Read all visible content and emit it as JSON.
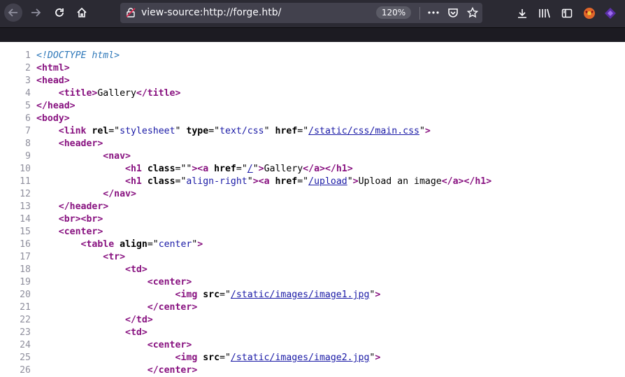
{
  "browser": {
    "url": "view-source:http://forge.htb/",
    "zoom": "120%"
  },
  "icons": {
    "back": "back-arrow-icon",
    "forward": "forward-arrow-icon",
    "reload": "reload-icon",
    "home": "home-icon",
    "insecure": "insecure-lock-icon",
    "more": "page-actions-icon",
    "pocket": "pocket-icon",
    "bookmark": "bookmark-star-icon",
    "downloads": "downloads-icon",
    "library": "library-icon",
    "sidebar": "sidebar-icon",
    "ext1": "extension-icon",
    "ext2": "extension-icon"
  },
  "colors": {
    "toolbar": "#2b2a33",
    "tag": "#881280",
    "value": "#1a1aa6",
    "doctype": "#2e78b9",
    "line_number": "#8f8f9d"
  },
  "source_lines": [
    {
      "n": "1",
      "parts": [
        {
          "t": "doctype",
          "s": "<!DOCTYPE html>"
        }
      ]
    },
    {
      "n": "2",
      "parts": [
        {
          "t": "tag",
          "s": "<html>"
        }
      ]
    },
    {
      "n": "3",
      "parts": [
        {
          "t": "tag",
          "s": "<head>"
        }
      ]
    },
    {
      "n": "4",
      "parts": [
        {
          "t": "txt",
          "s": "    "
        },
        {
          "t": "tag",
          "s": "<title>"
        },
        {
          "t": "txt",
          "s": "Gallery"
        },
        {
          "t": "tag",
          "s": "</title>"
        }
      ]
    },
    {
      "n": "5",
      "parts": [
        {
          "t": "tag",
          "s": "</head>"
        }
      ]
    },
    {
      "n": "6",
      "parts": [
        {
          "t": "tag",
          "s": "<body>"
        }
      ]
    },
    {
      "n": "7",
      "parts": [
        {
          "t": "txt",
          "s": "    "
        },
        {
          "t": "tag",
          "s": "<link "
        },
        {
          "t": "attr",
          "s": "rel"
        },
        {
          "t": "txt",
          "s": "=\""
        },
        {
          "t": "val",
          "s": "stylesheet"
        },
        {
          "t": "txt",
          "s": "\" "
        },
        {
          "t": "attr",
          "s": "type"
        },
        {
          "t": "txt",
          "s": "=\""
        },
        {
          "t": "val",
          "s": "text/css"
        },
        {
          "t": "txt",
          "s": "\" "
        },
        {
          "t": "attr",
          "s": "href"
        },
        {
          "t": "txt",
          "s": "=\""
        },
        {
          "t": "link",
          "s": "/static/css/main.css"
        },
        {
          "t": "txt",
          "s": "\""
        },
        {
          "t": "tag",
          "s": ">"
        }
      ]
    },
    {
      "n": "8",
      "parts": [
        {
          "t": "txt",
          "s": "    "
        },
        {
          "t": "tag",
          "s": "<header>"
        }
      ]
    },
    {
      "n": "9",
      "parts": [
        {
          "t": "txt",
          "s": "            "
        },
        {
          "t": "tag",
          "s": "<nav>"
        }
      ]
    },
    {
      "n": "10",
      "parts": [
        {
          "t": "txt",
          "s": "                "
        },
        {
          "t": "tag",
          "s": "<h1 "
        },
        {
          "t": "attr",
          "s": "class"
        },
        {
          "t": "txt",
          "s": "=\"\""
        },
        {
          "t": "tag",
          "s": "><a "
        },
        {
          "t": "attr",
          "s": "href"
        },
        {
          "t": "txt",
          "s": "=\""
        },
        {
          "t": "link",
          "s": "/"
        },
        {
          "t": "txt",
          "s": "\""
        },
        {
          "t": "tag",
          "s": ">"
        },
        {
          "t": "txt",
          "s": "Gallery"
        },
        {
          "t": "tag",
          "s": "</a></h1>"
        }
      ]
    },
    {
      "n": "11",
      "parts": [
        {
          "t": "txt",
          "s": "                "
        },
        {
          "t": "tag",
          "s": "<h1 "
        },
        {
          "t": "attr",
          "s": "class"
        },
        {
          "t": "txt",
          "s": "=\""
        },
        {
          "t": "val",
          "s": "align-right"
        },
        {
          "t": "txt",
          "s": "\""
        },
        {
          "t": "tag",
          "s": "><a "
        },
        {
          "t": "attr",
          "s": "href"
        },
        {
          "t": "txt",
          "s": "=\""
        },
        {
          "t": "link",
          "s": "/upload"
        },
        {
          "t": "txt",
          "s": "\""
        },
        {
          "t": "tag",
          "s": ">"
        },
        {
          "t": "txt",
          "s": "Upload an image"
        },
        {
          "t": "tag",
          "s": "</a></h1>"
        }
      ]
    },
    {
      "n": "12",
      "parts": [
        {
          "t": "txt",
          "s": "            "
        },
        {
          "t": "tag",
          "s": "</nav>"
        }
      ]
    },
    {
      "n": "13",
      "parts": [
        {
          "t": "txt",
          "s": "    "
        },
        {
          "t": "tag",
          "s": "</header>"
        }
      ]
    },
    {
      "n": "14",
      "parts": [
        {
          "t": "txt",
          "s": "    "
        },
        {
          "t": "tag",
          "s": "<br><br>"
        }
      ]
    },
    {
      "n": "15",
      "parts": [
        {
          "t": "txt",
          "s": "    "
        },
        {
          "t": "tag",
          "s": "<center>"
        }
      ]
    },
    {
      "n": "16",
      "parts": [
        {
          "t": "txt",
          "s": "        "
        },
        {
          "t": "tag",
          "s": "<table "
        },
        {
          "t": "attr",
          "s": "align"
        },
        {
          "t": "txt",
          "s": "=\""
        },
        {
          "t": "val",
          "s": "center"
        },
        {
          "t": "txt",
          "s": "\""
        },
        {
          "t": "tag",
          "s": ">"
        }
      ]
    },
    {
      "n": "17",
      "parts": [
        {
          "t": "txt",
          "s": "            "
        },
        {
          "t": "tag",
          "s": "<tr>"
        }
      ]
    },
    {
      "n": "18",
      "parts": [
        {
          "t": "txt",
          "s": "                "
        },
        {
          "t": "tag",
          "s": "<td>"
        }
      ]
    },
    {
      "n": "19",
      "parts": [
        {
          "t": "txt",
          "s": "                    "
        },
        {
          "t": "tag",
          "s": "<center>"
        }
      ]
    },
    {
      "n": "20",
      "parts": [
        {
          "t": "txt",
          "s": "                         "
        },
        {
          "t": "tag",
          "s": "<img "
        },
        {
          "t": "attr",
          "s": "src"
        },
        {
          "t": "txt",
          "s": "=\""
        },
        {
          "t": "link",
          "s": "/static/images/image1.jpg"
        },
        {
          "t": "txt",
          "s": "\""
        },
        {
          "t": "tag",
          "s": ">"
        }
      ]
    },
    {
      "n": "21",
      "parts": [
        {
          "t": "txt",
          "s": "                    "
        },
        {
          "t": "tag",
          "s": "</center>"
        }
      ]
    },
    {
      "n": "22",
      "parts": [
        {
          "t": "txt",
          "s": "                "
        },
        {
          "t": "tag",
          "s": "</td>"
        }
      ]
    },
    {
      "n": "23",
      "parts": [
        {
          "t": "txt",
          "s": "                "
        },
        {
          "t": "tag",
          "s": "<td>"
        }
      ]
    },
    {
      "n": "24",
      "parts": [
        {
          "t": "txt",
          "s": "                    "
        },
        {
          "t": "tag",
          "s": "<center>"
        }
      ]
    },
    {
      "n": "25",
      "parts": [
        {
          "t": "txt",
          "s": "                         "
        },
        {
          "t": "tag",
          "s": "<img "
        },
        {
          "t": "attr",
          "s": "src"
        },
        {
          "t": "txt",
          "s": "=\""
        },
        {
          "t": "link",
          "s": "/static/images/image2.jpg"
        },
        {
          "t": "txt",
          "s": "\""
        },
        {
          "t": "tag",
          "s": ">"
        }
      ]
    },
    {
      "n": "26",
      "parts": [
        {
          "t": "txt",
          "s": "                    "
        },
        {
          "t": "tag",
          "s": "</center>"
        }
      ]
    }
  ]
}
